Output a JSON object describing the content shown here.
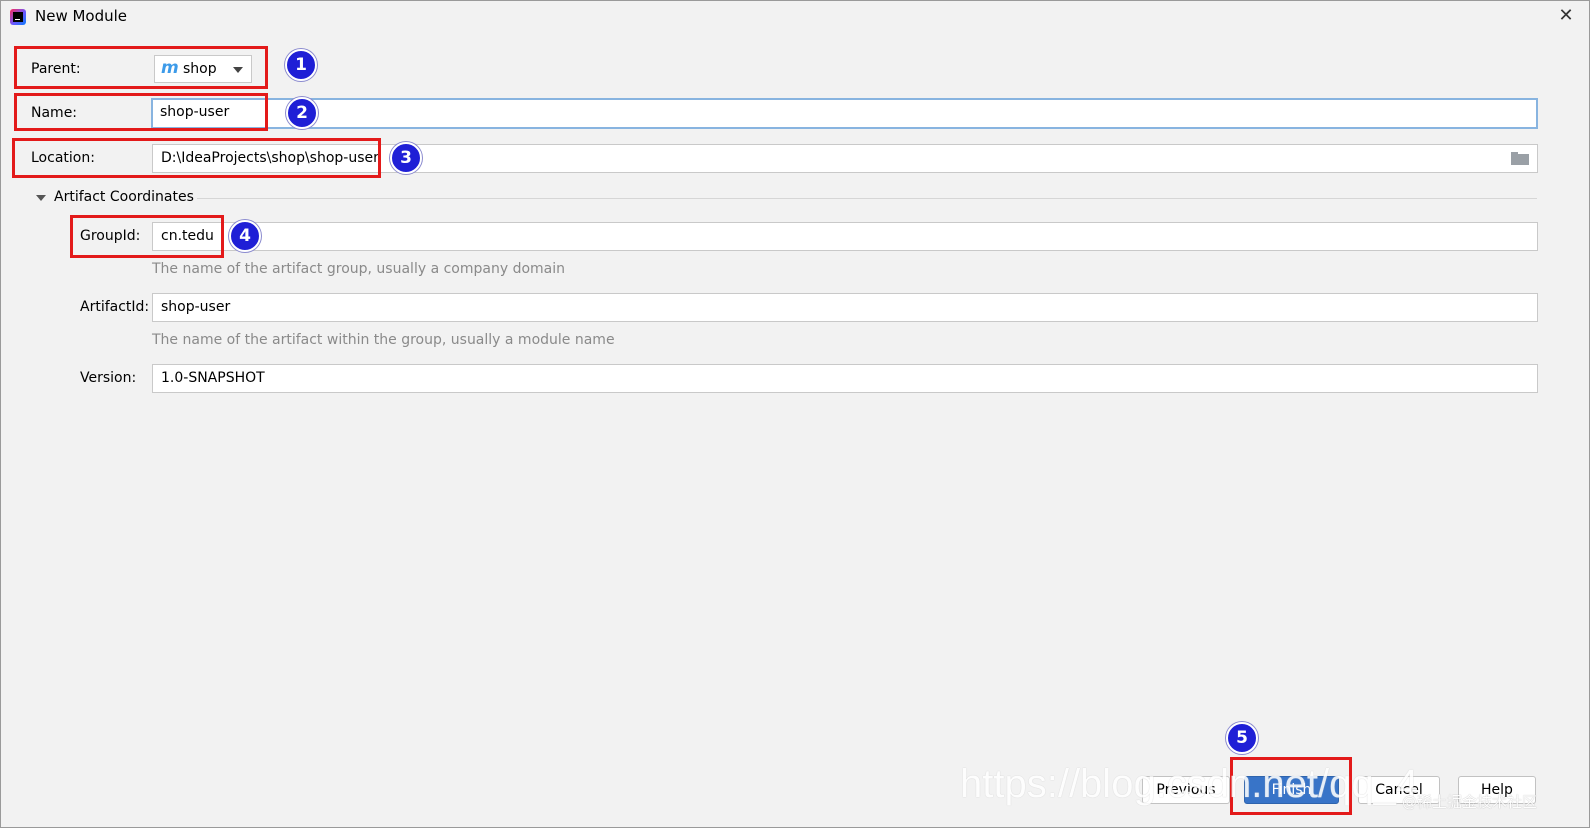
{
  "window": {
    "title": "New Module"
  },
  "form": {
    "parent_label": "Parent:",
    "parent_value": "shop",
    "name_label": "Name:",
    "name_value": "shop-user",
    "location_label": "Location:",
    "location_value": "D:\\IdeaProjects\\shop\\shop-user",
    "section_title": "Artifact Coordinates",
    "groupid_label": "GroupId:",
    "groupid_value": "cn.tedu",
    "groupid_hint": "The name of the artifact group, usually a company domain",
    "artifactid_label": "ArtifactId:",
    "artifactid_value": "shop-user",
    "artifactid_hint": "The name of the artifact within the group, usually a module name",
    "version_label": "Version:",
    "version_value": "1.0-SNAPSHOT"
  },
  "buttons": {
    "previous": "Previous",
    "finish": "Finish",
    "cancel": "Cancel",
    "help": "Help"
  },
  "annotations": [
    "1",
    "2",
    "3",
    "4",
    "5"
  ],
  "watermark": {
    "url": "https://blog.csdn.net/qq_4",
    "community": "@稀土掘金技术社区"
  },
  "colors": {
    "annotation_box": "#e31a1a",
    "annotation_badge": "#1f1fd6",
    "primary_button": "#3874c8",
    "focus_border": "#88b4e0"
  }
}
